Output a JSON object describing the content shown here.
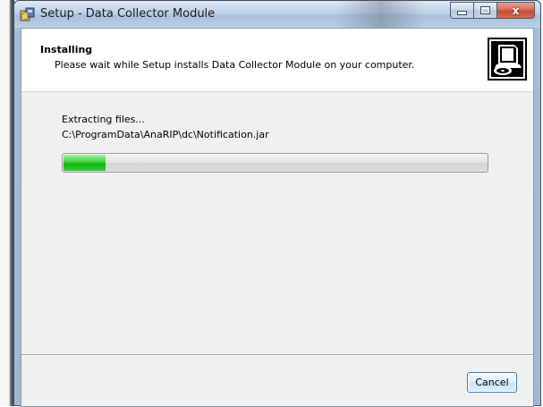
{
  "window": {
    "title": "Setup - Data Collector Module",
    "caption_close": "x"
  },
  "header": {
    "title": "Installing",
    "subtitle": "Please wait while Setup installs Data Collector Module on your computer."
  },
  "body": {
    "status": "Extracting files...",
    "current_file": "C:\\ProgramData\\AnaRIP\\dc\\Notification.jar",
    "progress_fraction": 0.1
  },
  "footer": {
    "cancel_label": "Cancel"
  },
  "colors": {
    "progress_fill": "#22bb22",
    "button_border": "#3c7fb1",
    "close_button": "#c44a37"
  },
  "icons": {
    "app": "setup-box-icon",
    "wizard": "computer-disc-icon"
  }
}
